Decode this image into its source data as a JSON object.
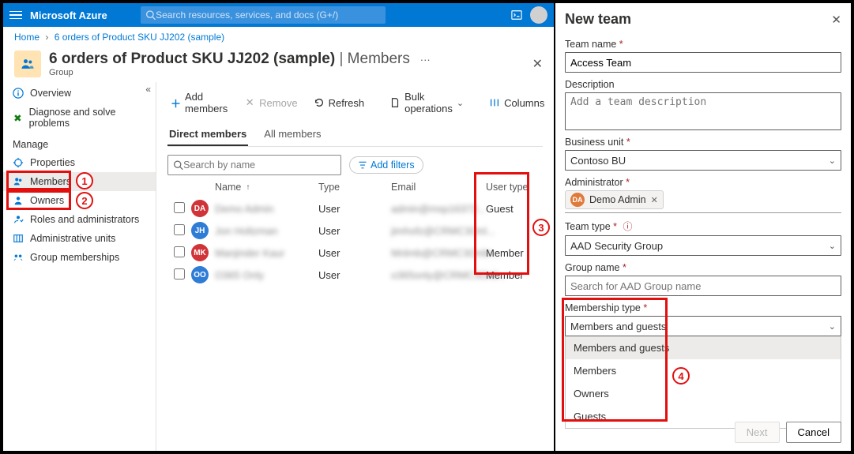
{
  "azure": {
    "brand": "Microsoft Azure",
    "search_placeholder": "Search resources, services, and docs (G+/)"
  },
  "crumbs": {
    "home": "Home",
    "current": "6 orders of Product SKU JJ202 (sample)"
  },
  "page": {
    "title_main": "6 orders of Product SKU JJ202 (sample)",
    "title_suffix": "Members",
    "subtitle": "Group"
  },
  "sidebar": {
    "overview": "Overview",
    "diagnose": "Diagnose and solve problems",
    "manage_head": "Manage",
    "items": [
      {
        "label": "Properties"
      },
      {
        "label": "Members"
      },
      {
        "label": "Owners"
      },
      {
        "label": "Roles and administrators"
      },
      {
        "label": "Administrative units"
      },
      {
        "label": "Group memberships"
      }
    ]
  },
  "cmd": {
    "add": "Add members",
    "remove": "Remove",
    "refresh": "Refresh",
    "bulk": "Bulk operations",
    "columns": "Columns",
    "more": "···"
  },
  "tabs": {
    "direct": "Direct members",
    "all": "All members"
  },
  "filters": {
    "search_placeholder": "Search by name",
    "add_filters": "Add filters"
  },
  "tableHead": {
    "name": "Name",
    "type": "Type",
    "email": "Email",
    "usertype": "User type"
  },
  "rows": [
    {
      "initials": "DA",
      "color": "#d13438",
      "name": "Demo Admin",
      "type": "User",
      "email": "admin@msp16372...",
      "usertype": "Guest"
    },
    {
      "initials": "JH",
      "color": "#2e7cd6",
      "name": "Jon Holtzman",
      "type": "User",
      "email": "jimhofz@CRMC3Onl...",
      "usertype": ""
    },
    {
      "initials": "MK",
      "color": "#d13438",
      "name": "Manjinder Kaur",
      "type": "User",
      "email": "Mnlmb@CRMC3Onlin...",
      "usertype": "Member"
    },
    {
      "initials": "OO",
      "color": "#2e7cd6",
      "name": "O365 Only",
      "type": "User",
      "email": "o365only@CRMC3Onli...",
      "usertype": "Member"
    }
  ],
  "callouts": {
    "c1": "1",
    "c2": "2",
    "c3": "3",
    "c4": "4"
  },
  "panel": {
    "title": "New team",
    "team_name_label": "Team name",
    "team_name_value": "Access Team",
    "desc_label": "Description",
    "desc_placeholder": "Add a team description",
    "bu_label": "Business unit",
    "bu_value": "Contoso BU",
    "admin_label": "Administrator",
    "admin_value": "Demo Admin",
    "admin_initials": "DA",
    "team_type_label": "Team type",
    "team_type_value": "AAD Security Group",
    "group_name_label": "Group name",
    "group_name_placeholder": "Search for AAD Group name",
    "membership_label": "Membership type",
    "membership_value": "Members and guests",
    "membership_options": [
      "Members and guests",
      "Members",
      "Owners",
      "Guests"
    ],
    "next": "Next",
    "cancel": "Cancel"
  }
}
